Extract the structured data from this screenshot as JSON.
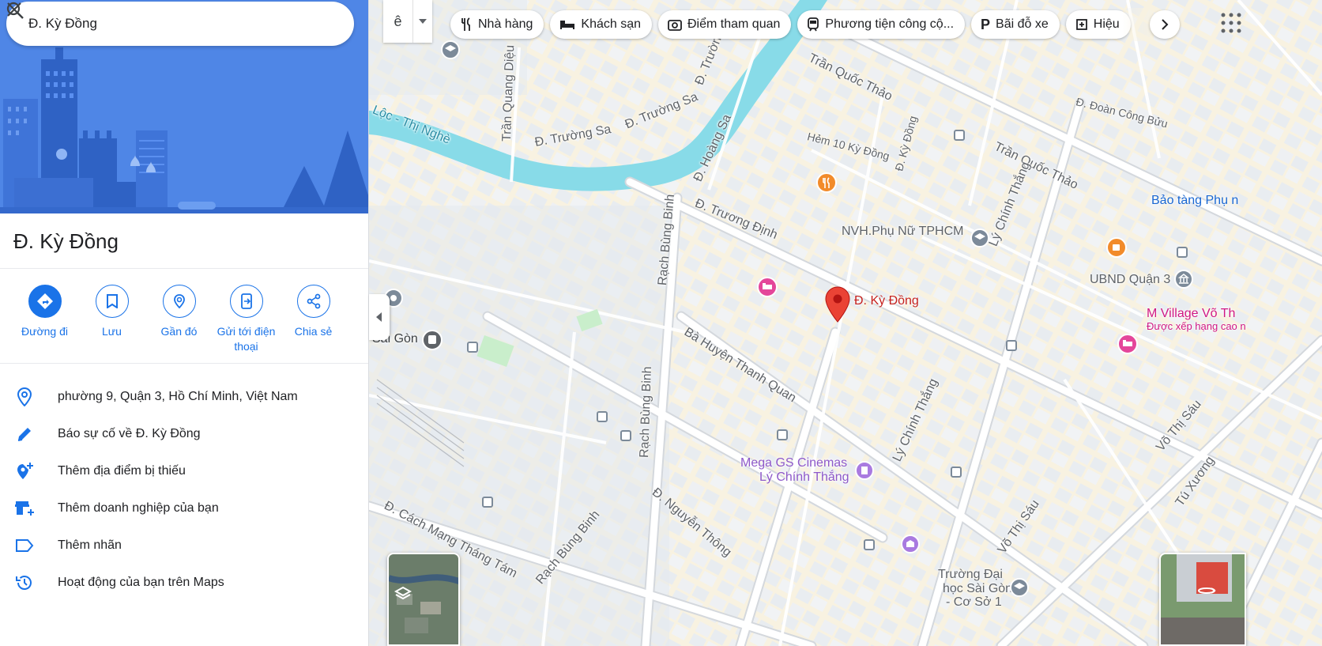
{
  "search": {
    "value": "Đ. Kỳ Đồng",
    "search_icon": "search-icon",
    "clear_icon": "close-icon"
  },
  "place": {
    "title": "Đ. Kỳ Đồng"
  },
  "actions": [
    {
      "label": "Đường đi",
      "icon": "directions-icon"
    },
    {
      "label": "Lưu",
      "icon": "bookmark-icon"
    },
    {
      "label": "Gần đó",
      "icon": "nearby-icon"
    },
    {
      "label": "Gửi tới điện thoại",
      "icon": "send-to-phone-icon"
    },
    {
      "label": "Chia sẻ",
      "icon": "share-icon"
    }
  ],
  "info_rows": [
    {
      "text": "phường 9, Quận 3, Hồ Chí Minh, Việt Nam",
      "icon": "location-pin-icon"
    },
    {
      "text": "Báo sự cố về Đ. Kỳ Đồng",
      "icon": "pencil-icon"
    },
    {
      "text": "Thêm địa điểm bị thiếu",
      "icon": "add-location-icon"
    },
    {
      "text": "Thêm doanh nghiệp của bạn",
      "icon": "add-business-icon"
    },
    {
      "text": "Thêm nhãn",
      "icon": "label-icon"
    },
    {
      "text": "Hoạt động của bạn trên Maps",
      "icon": "history-icon"
    }
  ],
  "language_toggle": {
    "label": "ê"
  },
  "chips": [
    {
      "label": "Nhà hàng",
      "icon": "restaurant-icon"
    },
    {
      "label": "Khách sạn",
      "icon": "hotel-icon"
    },
    {
      "label": "Điểm tham quan",
      "icon": "camera-icon"
    },
    {
      "label": "Phương tiện công cộ...",
      "icon": "transit-icon"
    },
    {
      "label": "Bãi đỗ xe",
      "icon": "parking-icon"
    },
    {
      "label": "Hiệu",
      "icon": "pharmacy-icon"
    }
  ],
  "map_labels": {
    "street_truong_sa_1": "Đ. Trường Sa",
    "street_truong_sa_2": "Đ. Trường Sa",
    "street_truong_sa_3": "Đ. Trường",
    "street_hoang_sa": "Đ. Hoàng Sa",
    "street_truong_dinh": "Đ. Trương Định",
    "street_tran_quoc_thao_1": "Trần Quốc Thảo",
    "street_tran_quoc_thao_2": "Trần Quốc Thảo",
    "street_doan_cong_buu": "Đ. Đoàn Công Bửu",
    "street_hem_10": "Hẻm 10 Kỳ Đồng",
    "street_ky_dong": "Đ. Kỳ Đồng",
    "street_ly_chinh_thang_1": "Lý Chính Thắng",
    "street_ly_chinh_thang_2": "Lý Chính Thắng",
    "street_rach_bung_binh_1": "Rạch Bùng Binh",
    "street_rach_bung_binh_2": "Rạch Bùng Binh",
    "street_rach_bung_binh_3": "Rạch Bùng Binh",
    "street_ba_huyen": "Bà Huyện Thanh Quan",
    "street_nguyen_thong": "Đ. Nguyễn Thông",
    "street_cmt8": "Đ. Cách Mạng Tháng Tám",
    "street_vo_thi_sau_1": "Võ Thị Sáu",
    "street_vo_thi_sau_2": "Võ Thị Sáu",
    "street_tu_xuong": "Tú Xương",
    "street_tran_quang_dieu": "Trần Quang Diệu",
    "canal_nhieu_loc": "Lộc - Thị Nghè",
    "place_sai_gon": "Sài Gòn",
    "place_nvh": "NVH.Phụ Nữ TPHCM",
    "place_ubnd": "UBND Quận 3",
    "place_bao_tang": "Bảo tàng Phụ n",
    "place_m_village": "M Village Võ Th",
    "place_m_village_sub": "Được xếp hạng cao n",
    "place_mega_gs_1": "Mega GS Cinemas",
    "place_mega_gs_2": "Lý Chính Thắng",
    "place_truong_dh_1": "Trường Đại",
    "place_truong_dh_2": "học Sài Gòn",
    "place_truong_dh_3": "- Cơ Sở 1",
    "marker": "Đ. Kỳ Đồng"
  },
  "colors": {
    "accent": "#1a73e8",
    "marker": "#ea4335",
    "water": "#88dbe8",
    "hotel_poi": "#e4469a",
    "food_poi": "#f28b2a",
    "cinema_poi": "#a97ae0"
  }
}
